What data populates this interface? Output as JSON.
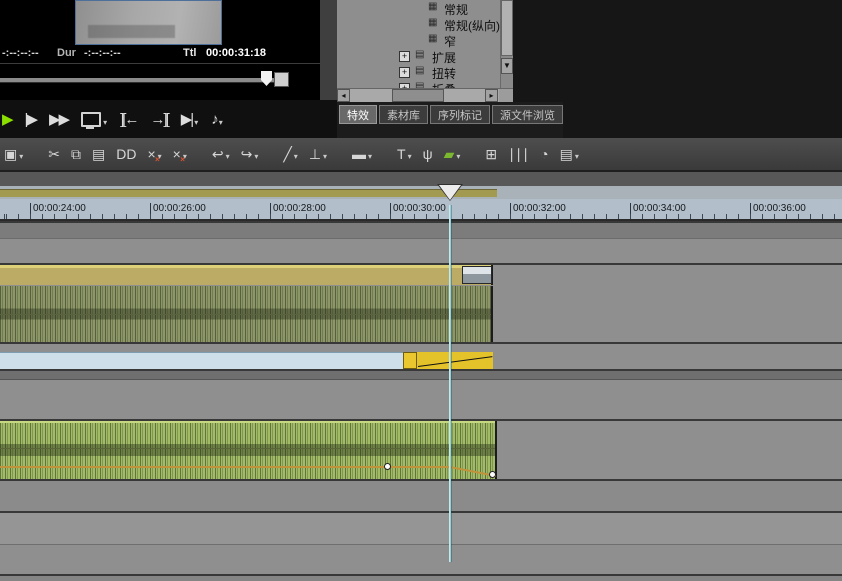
{
  "monitor": {
    "tc_current": "-:--:--:--",
    "dur_label": "Dur",
    "dur_value": "-:--:--:--",
    "total_label": "Ttl",
    "total_value": "00:00:31:18"
  },
  "palette": {
    "tree_items": [
      {
        "label": "常规",
        "type": "leaf"
      },
      {
        "label": "常规(纵向)",
        "type": "leaf"
      },
      {
        "label": "窄",
        "type": "leaf"
      },
      {
        "label": "扩展",
        "type": "branch"
      },
      {
        "label": "扭转",
        "type": "branch"
      },
      {
        "label": "折叠",
        "type": "branch"
      }
    ],
    "tabs": [
      {
        "label": "特效",
        "active": true
      },
      {
        "label": "素材库",
        "active": false
      },
      {
        "label": "序列标记",
        "active": false
      },
      {
        "label": "源文件浏览",
        "active": false
      }
    ]
  },
  "icons": {
    "caret": "▾",
    "tree_expand": "+",
    "tree_folder": "▤",
    "tree_preset": "▦",
    "scroll_down": "▼",
    "scroll_left": "◂",
    "scroll_right": "▸",
    "accent_mark": "×"
  },
  "transport": {
    "icons": [
      {
        "name": "play-button",
        "glyph": "▶",
        "color": "#8ce000"
      },
      {
        "name": "frame-play-button",
        "glyph": "|▶"
      },
      {
        "name": "fast-forward-button",
        "glyph": "▶▶"
      },
      {
        "name": "monitor-toggle-button",
        "shape": "monitor",
        "caret": true
      },
      {
        "name": "set-in-point-button",
        "glyph": "][←"
      },
      {
        "name": "set-out-point-button",
        "glyph": "→]["
      },
      {
        "name": "play-around-button",
        "glyph": "▶|",
        "caret": true
      },
      {
        "name": "loop-play-button",
        "glyph": "♪",
        "caret": true
      }
    ]
  },
  "toolbar": {
    "icons": [
      {
        "name": "save-button",
        "glyph": "▣",
        "caret": true
      },
      {
        "name": "cut-button",
        "glyph": "✂",
        "gap": true
      },
      {
        "name": "copy-button",
        "glyph": "⧉"
      },
      {
        "name": "paste-button",
        "glyph": "▤"
      },
      {
        "name": "duplicate-button",
        "glyph": "DD"
      },
      {
        "name": "delete-button",
        "glyph": "×",
        "accent": true,
        "caret": true
      },
      {
        "name": "ripple-delete-button",
        "glyph": "×",
        "accent": true,
        "caret": true
      },
      {
        "name": "undo-button",
        "glyph": "↩",
        "caret": true,
        "gap": true
      },
      {
        "name": "redo-button",
        "glyph": "↪",
        "caret": true
      },
      {
        "name": "trim-button",
        "glyph": "╱",
        "caret": true,
        "gap": true
      },
      {
        "name": "add-cut-point-button",
        "glyph": "⊥",
        "caret": true
      },
      {
        "name": "transition-button",
        "glyph": "▬",
        "caret": true,
        "gap": true
      },
      {
        "name": "title-button",
        "glyph": "T",
        "caret": true,
        "gap": true
      },
      {
        "name": "voiceover-button",
        "glyph": "ψ"
      },
      {
        "name": "export-button",
        "glyph": "▰",
        "color": "#7cb82f",
        "caret": true
      },
      {
        "name": "grid-button",
        "glyph": "⊞",
        "gap": true
      },
      {
        "name": "mixer-button",
        "glyph": "∣∣∣"
      },
      {
        "name": "playback-settings-button",
        "glyph": "◔"
      },
      {
        "name": "bin-button",
        "glyph": "▤",
        "caret": true
      }
    ]
  },
  "timeline": {
    "ruler_labels": [
      "00:00:24:00",
      "00:00:26:00",
      "00:00:28:00",
      "00:00:30:00",
      "00:00:32:00",
      "00:00:34:00",
      "00:00:36:00"
    ]
  },
  "colors": {
    "video_clip": "#bcab65",
    "audio_clip_olive": "#8d9666",
    "audio_clip_green": "#a2bc66",
    "keyframe_yellow": "#e4c22a",
    "automation_orange": "#c0933a",
    "playhead_cyan": "#9fdde6",
    "play_green": "#8ce000"
  }
}
